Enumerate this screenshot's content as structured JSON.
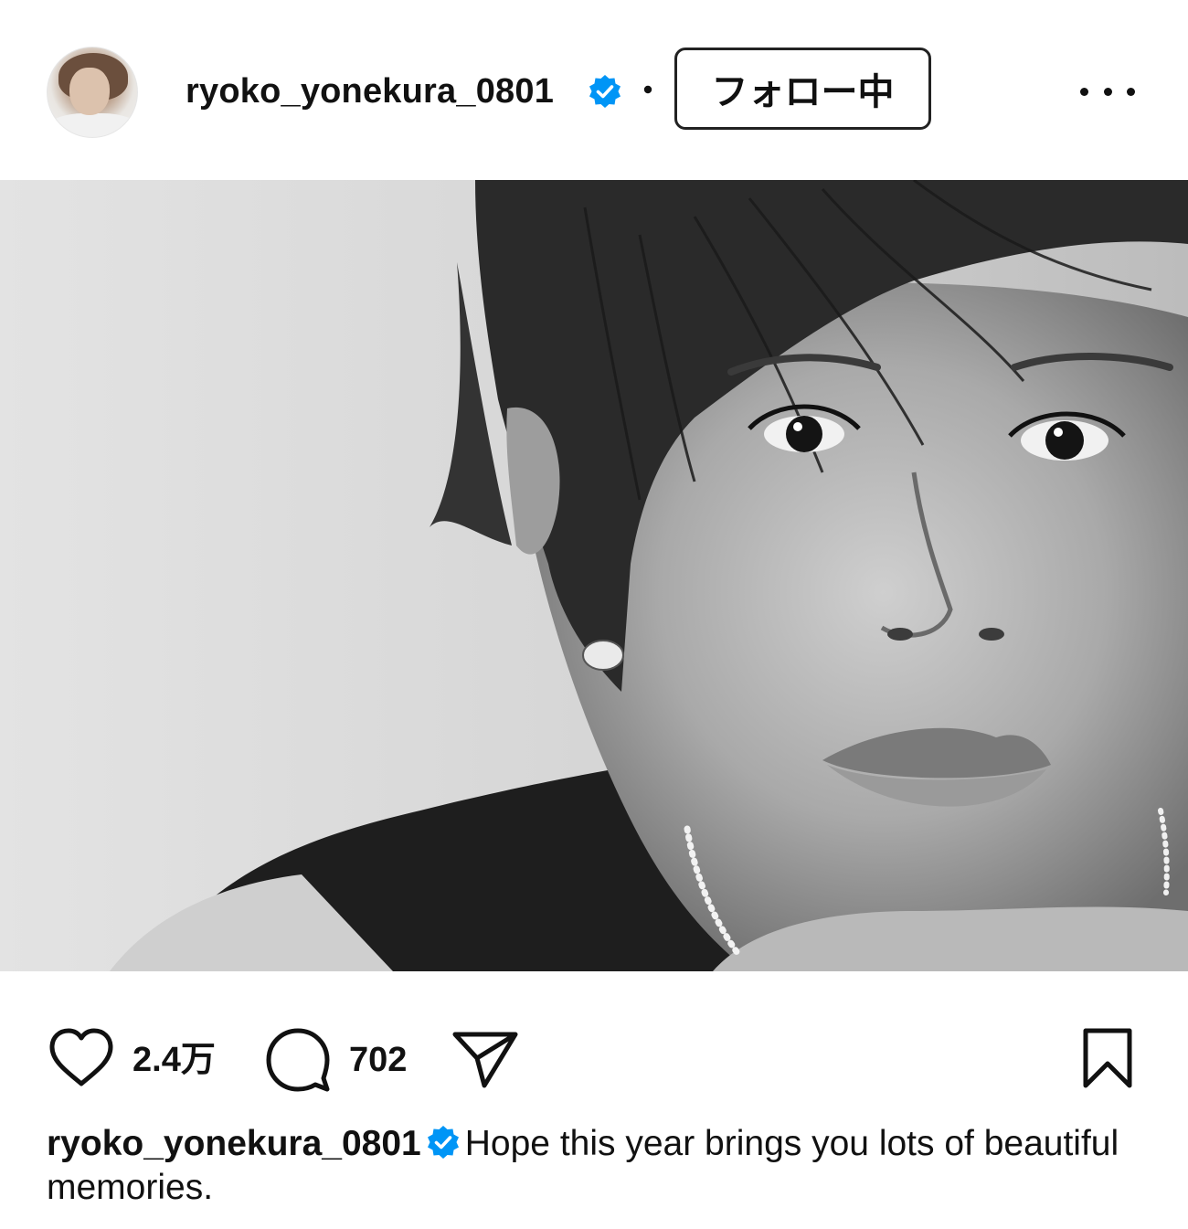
{
  "post": {
    "username": "ryoko_yonekura_0801",
    "verified": true,
    "follow_label": "フォロー中",
    "separator": "•",
    "more_icon": "more-horizontal-icon"
  },
  "stats": {
    "likes": "2.4万",
    "comments": "702"
  },
  "caption": {
    "username": "ryoko_yonekura_0801",
    "text": "Hope this year brings you lots of beautiful memories."
  },
  "colors": {
    "verified_blue": "#0095f6",
    "text": "#111111",
    "background": "#ffffff"
  },
  "icons": [
    "heart-icon",
    "comment-icon",
    "share-icon",
    "bookmark-icon",
    "verified-badge-icon"
  ]
}
